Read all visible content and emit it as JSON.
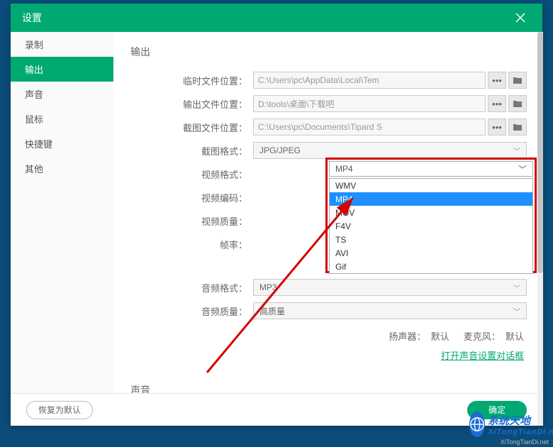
{
  "titlebar": {
    "title": "设置"
  },
  "sidebar": {
    "items": [
      {
        "label": "录制"
      },
      {
        "label": "输出"
      },
      {
        "label": "声音"
      },
      {
        "label": "鼠标"
      },
      {
        "label": "快捷键"
      },
      {
        "label": "其他"
      }
    ],
    "active_index": 1
  },
  "content": {
    "section_title": "输出",
    "rows": {
      "temp_path": {
        "label": "临时文件位置：",
        "value": "C:\\Users\\pc\\AppData\\Local\\Tem"
      },
      "output_path": {
        "label": "输出文件位置：",
        "value": "D:\\tools\\桌面\\下载吧"
      },
      "screenshot_path": {
        "label": "截图文件位置：",
        "value": "C:\\Users\\pc\\Documents\\Tipard S"
      },
      "screenshot_fmt": {
        "label": "截图格式：",
        "value": "JPG/JPEG"
      },
      "video_fmt": {
        "label": "视频格式：",
        "value": "MP4"
      },
      "video_codec": {
        "label": "视频编码："
      },
      "video_quality": {
        "label": "视频质量："
      },
      "fps": {
        "label": "帧率："
      },
      "audio_fmt": {
        "label": "音频格式：",
        "value": "MP3"
      },
      "audio_quality": {
        "label": "音频质量：",
        "value": "高质量"
      }
    },
    "dropdown": {
      "options": [
        "WMV",
        "MP4",
        "MOV",
        "F4V",
        "TS",
        "AVI",
        "Gif"
      ],
      "highlight": "MP4"
    },
    "speaker": {
      "label1": "扬声器：",
      "value1": "默认",
      "label2": "麦克风：",
      "value2": "默认"
    },
    "link": "打开声音设置对话框",
    "section2_title": "声音"
  },
  "footer": {
    "restore": "恢复为默认",
    "ok": "确定"
  },
  "badge": {
    "line1": "系统天地",
    "line2": "XiTongTianDi.net"
  },
  "watermark": "XiTongTianDi.net"
}
